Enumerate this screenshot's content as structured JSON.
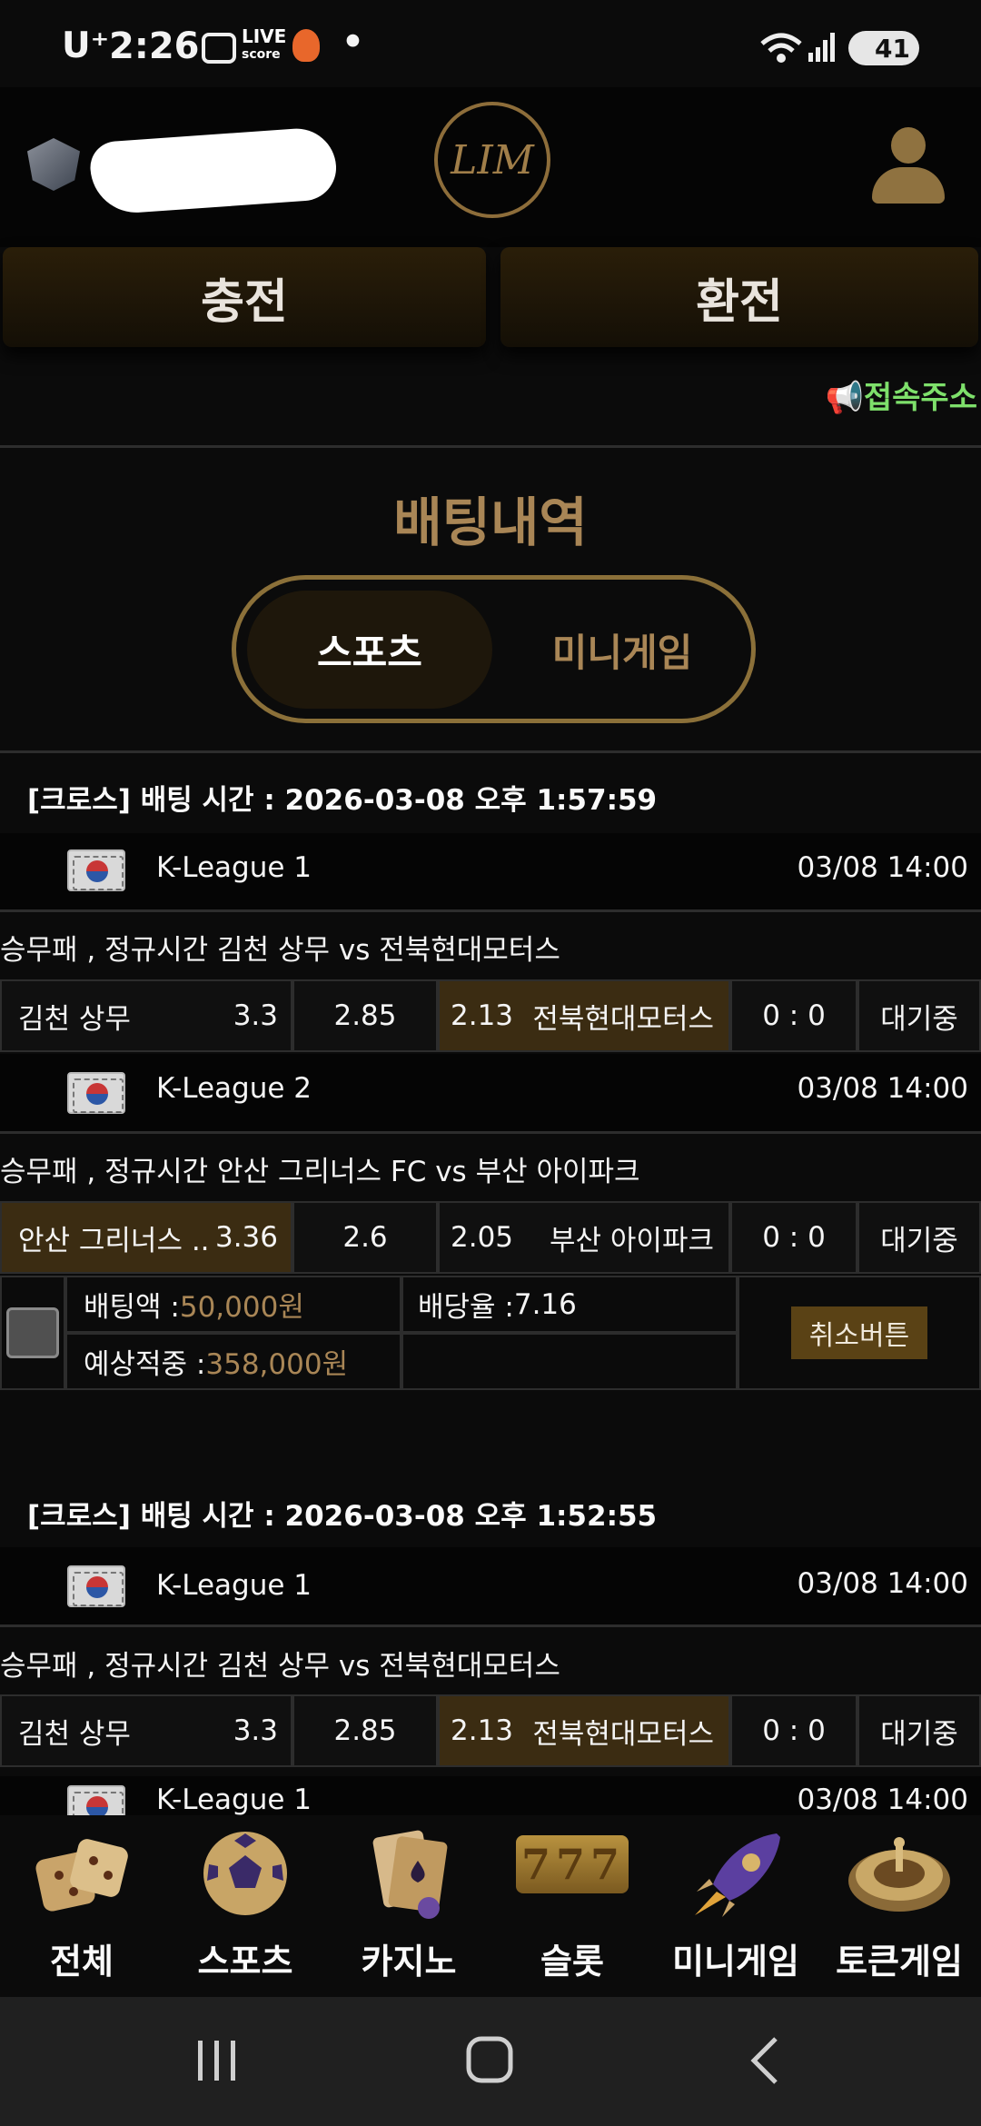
{
  "status": {
    "carrier": "U⁺",
    "time": "2:26",
    "live_score_top": "LIVE",
    "live_score_bottom": "score",
    "dot": "•",
    "battery": "41"
  },
  "header": {
    "logo_text": "LIM",
    "charge_label": "충전",
    "exchange_label": "환전",
    "access_address_label": "📢접속주소"
  },
  "page": {
    "title": "배팅내역",
    "tabs": [
      {
        "label": "스포츠",
        "active": true
      },
      {
        "label": "미니게임",
        "active": false
      }
    ]
  },
  "bets": [
    {
      "header": "[크로스] 배팅 시간 : 2026-03-08 오후 1:57:59",
      "games": [
        {
          "league": "K-League 1",
          "date": "03/08 14:00",
          "match": "승무패 , 정규시간 김천 상무  vs  전북현대모터스",
          "home": "김천 상무",
          "home_odds": "3.3",
          "draw_odds": "2.85",
          "away_odds": "2.13",
          "away": "전북현대모터스",
          "score": "0 : 0",
          "status": "대기중",
          "selected": "away"
        },
        {
          "league": "K-League 2",
          "date": "03/08 14:00",
          "match": "승무패 , 정규시간 안산 그리너스 FC  vs  부산 아이파크",
          "home": "안산 그리너스 ..",
          "home_odds": "3.36",
          "draw_odds": "2.6",
          "away_odds": "2.05",
          "away": "부산 아이파크",
          "score": "0 : 0",
          "status": "대기중",
          "selected": "home"
        }
      ],
      "summary": {
        "bet_amount_label": "배팅액 : ",
        "bet_amount": "50,000원",
        "odds_label": "배당율 : ",
        "odds": "7.16",
        "expected_label": "예상적중 : ",
        "expected": "358,000원",
        "cancel_label": "취소버튼"
      }
    },
    {
      "header": "[크로스] 배팅 시간 : 2026-03-08 오후 1:52:55",
      "games": [
        {
          "league": "K-League 1",
          "date": "03/08 14:00",
          "match": "승무패 , 정규시간 김천 상무  vs  전북현대모터스",
          "home": "김천 상무",
          "home_odds": "3.3",
          "draw_odds": "2.85",
          "away_odds": "2.13",
          "away": "전북현대모터스",
          "score": "0 : 0",
          "status": "대기중",
          "selected": "away"
        },
        {
          "league": "K-League 1",
          "date": "03/08 14:00"
        }
      ]
    }
  ],
  "bottom_nav": [
    {
      "label": "전체",
      "icon": "dice-icon"
    },
    {
      "label": "스포츠",
      "icon": "soccer-ball-icon"
    },
    {
      "label": "카지노",
      "icon": "cards-icon"
    },
    {
      "label": "슬롯",
      "icon": "slot-777-icon"
    },
    {
      "label": "미니게임",
      "icon": "rocket-icon"
    },
    {
      "label": "토큰게임",
      "icon": "roulette-icon"
    }
  ],
  "slot_digits": "777"
}
